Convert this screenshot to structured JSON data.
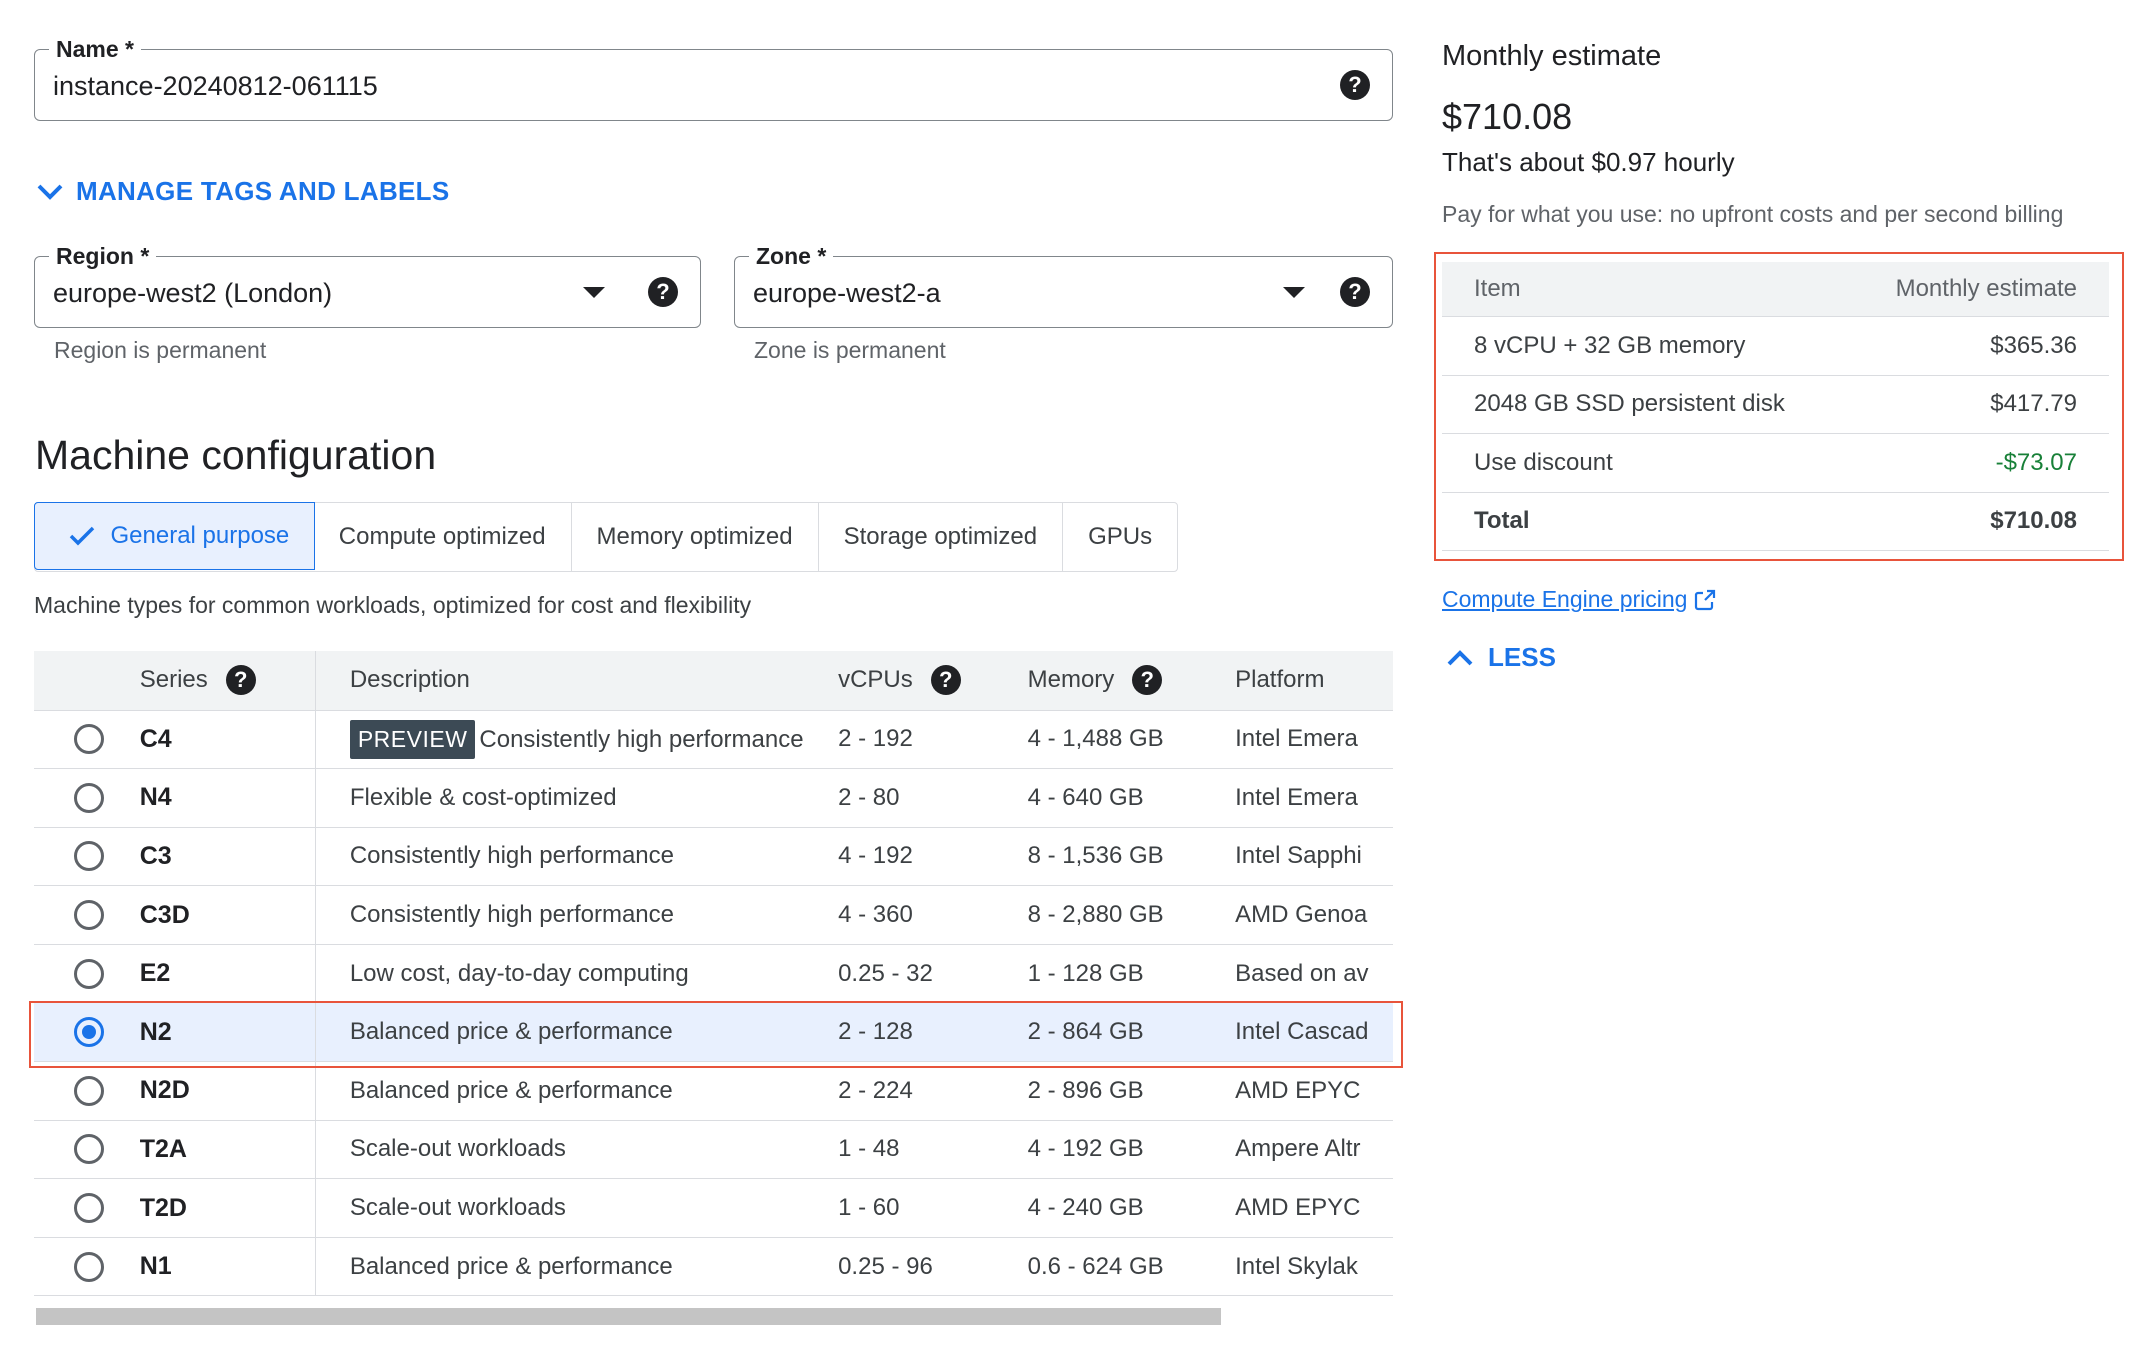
{
  "form": {
    "name": {
      "label": "Name *",
      "value": "instance-20240812-061115"
    },
    "manage_tags_label": "MANAGE TAGS AND LABELS",
    "region": {
      "label": "Region *",
      "value": "europe-west2 (London)",
      "hint": "Region is permanent"
    },
    "zone": {
      "label": "Zone *",
      "value": "europe-west2-a",
      "hint": "Zone is permanent"
    }
  },
  "machine_config": {
    "title": "Machine configuration",
    "tabs": [
      {
        "label": "General purpose",
        "active": true
      },
      {
        "label": "Compute optimized"
      },
      {
        "label": "Memory optimized"
      },
      {
        "label": "Storage optimized"
      },
      {
        "label": "GPUs"
      }
    ],
    "tab_description": "Machine types for common workloads, optimized for cost and flexibility",
    "columns": {
      "series": "Series",
      "description": "Description",
      "vcpus": "vCPUs",
      "memory": "Memory",
      "platform": "Platform"
    },
    "preview_badge": "PREVIEW",
    "rows": [
      {
        "series": "C4",
        "description": "Consistently high performance",
        "vcpus": "2 - 192",
        "memory": "4 - 1,488 GB",
        "platform": "Intel Emera"
      },
      {
        "series": "N4",
        "description": "Flexible & cost-optimized",
        "vcpus": "2 - 80",
        "memory": "4 - 640 GB",
        "platform": "Intel Emera"
      },
      {
        "series": "C3",
        "description": "Consistently high performance",
        "vcpus": "4 - 192",
        "memory": "8 - 1,536 GB",
        "platform": "Intel Sapphi"
      },
      {
        "series": "C3D",
        "description": "Consistently high performance",
        "vcpus": "4 - 360",
        "memory": "8 - 2,880 GB",
        "platform": "AMD Genoa"
      },
      {
        "series": "E2",
        "description": "Low cost, day-to-day computing",
        "vcpus": "0.25 - 32",
        "memory": "1 - 128 GB",
        "platform": "Based on av"
      },
      {
        "series": "N2",
        "description": "Balanced price & performance",
        "vcpus": "2 - 128",
        "memory": "2 - 864 GB",
        "platform": "Intel Cascad"
      },
      {
        "series": "N2D",
        "description": "Balanced price & performance",
        "vcpus": "2 - 224",
        "memory": "2 - 896 GB",
        "platform": "AMD EPYC"
      },
      {
        "series": "T2A",
        "description": "Scale-out workloads",
        "vcpus": "1 - 48",
        "memory": "4 - 192 GB",
        "platform": "Ampere Altr"
      },
      {
        "series": "T2D",
        "description": "Scale-out workloads",
        "vcpus": "1 - 60",
        "memory": "4 - 240 GB",
        "platform": "AMD EPYC"
      },
      {
        "series": "N1",
        "description": "Balanced price & performance",
        "vcpus": "0.25 - 96",
        "memory": "0.6 - 624 GB",
        "platform": "Intel Skylak"
      }
    ]
  },
  "estimate": {
    "title": "Monthly estimate",
    "amount": "$710.08",
    "hourly": "That's about $0.97 hourly",
    "note": "Pay for what you use: no upfront costs and per second billing",
    "table_head": {
      "item": "Item",
      "estimate": "Monthly estimate"
    },
    "items": [
      {
        "item": "8 vCPU + 32 GB memory",
        "cost": "$365.36"
      },
      {
        "item": "2048 GB SSD persistent disk",
        "cost": "$417.79"
      },
      {
        "item": "Use discount",
        "cost": "-$73.07"
      }
    ],
    "total": {
      "item": "Total",
      "cost": "$710.08"
    },
    "pricing_link": "Compute Engine pricing",
    "less_label": "LESS"
  },
  "colors": {
    "accent": "#1a73e8",
    "highlight": "#e8543b",
    "discount": "#188038"
  }
}
